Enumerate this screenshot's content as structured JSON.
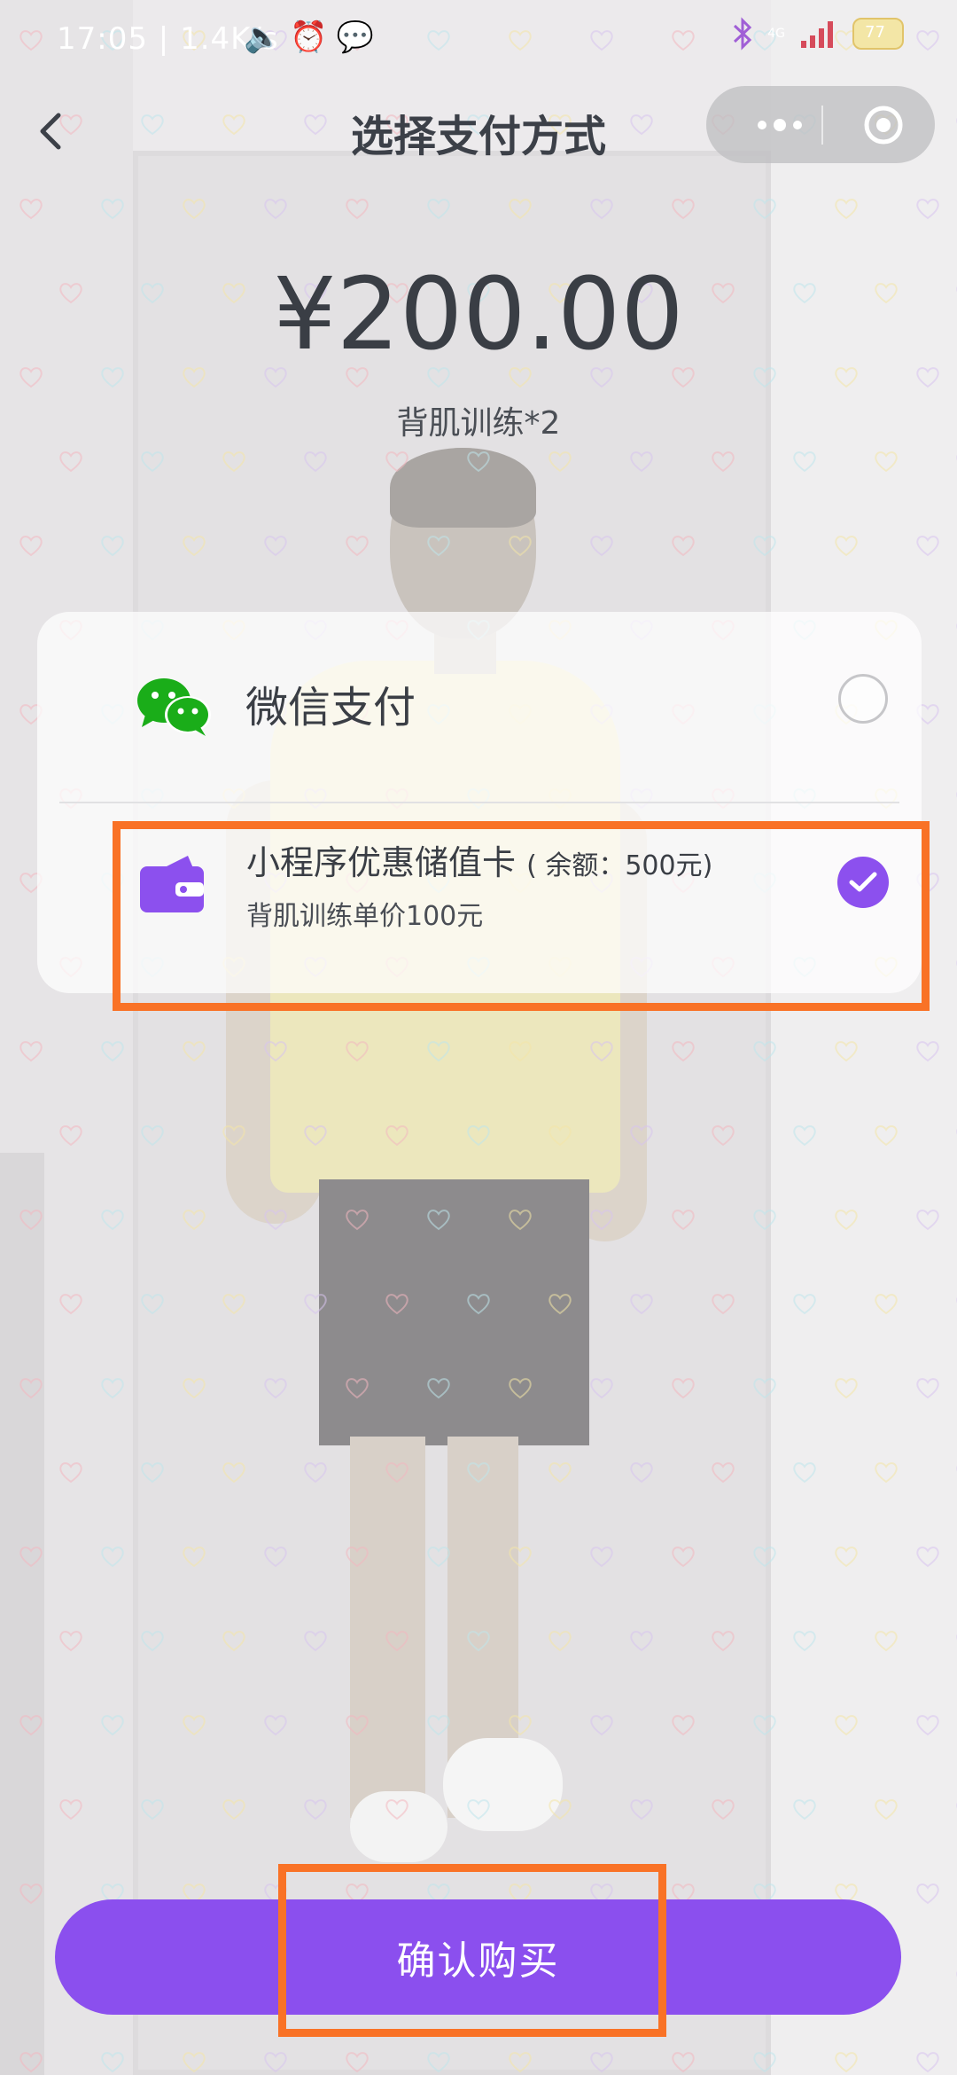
{
  "status_bar": {
    "time": "17:05",
    "speed": "1.4K/s",
    "network": "4G",
    "battery": "77"
  },
  "header": {
    "title": "选择支付方式",
    "back_icon": "chevron-left-icon",
    "more_icon": "more-dots-icon",
    "close_icon": "target-close-icon"
  },
  "order": {
    "amount": "¥200.00",
    "description": "背肌训练*2"
  },
  "payment_options": [
    {
      "label": "微信支付",
      "icon": "wechat-icon",
      "selected": false
    },
    {
      "label": "小程序优惠储值卡",
      "balance": "( 余额：500元)",
      "note": "背肌训练单价100元",
      "icon": "wallet-icon",
      "selected": true
    }
  ],
  "actions": {
    "confirm_label": "确认购买"
  },
  "colors": {
    "accent": "#8b4fee",
    "wechat_green": "#1aad19",
    "highlight": "#f97226"
  }
}
